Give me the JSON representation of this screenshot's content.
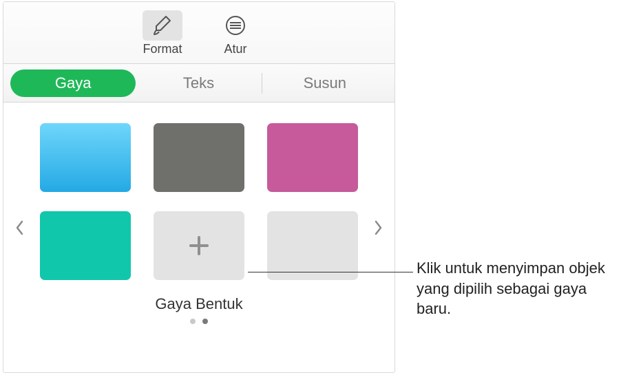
{
  "toolbar": {
    "format_label": "Format",
    "arrange_label": "Atur"
  },
  "tabs": {
    "style": "Gaya",
    "text": "Teks",
    "arrange": "Susun"
  },
  "styles": {
    "section_label": "Gaya Bentuk",
    "swatch_blue": "blue-gradient",
    "swatch_gray": "gray-texture",
    "swatch_pink": "magenta",
    "swatch_teal": "teal",
    "swatch_add": "add-style",
    "swatch_empty": "empty"
  },
  "callout": {
    "text": "Klik untuk menyimpan objek yang dipilih sebagai gaya baru."
  }
}
